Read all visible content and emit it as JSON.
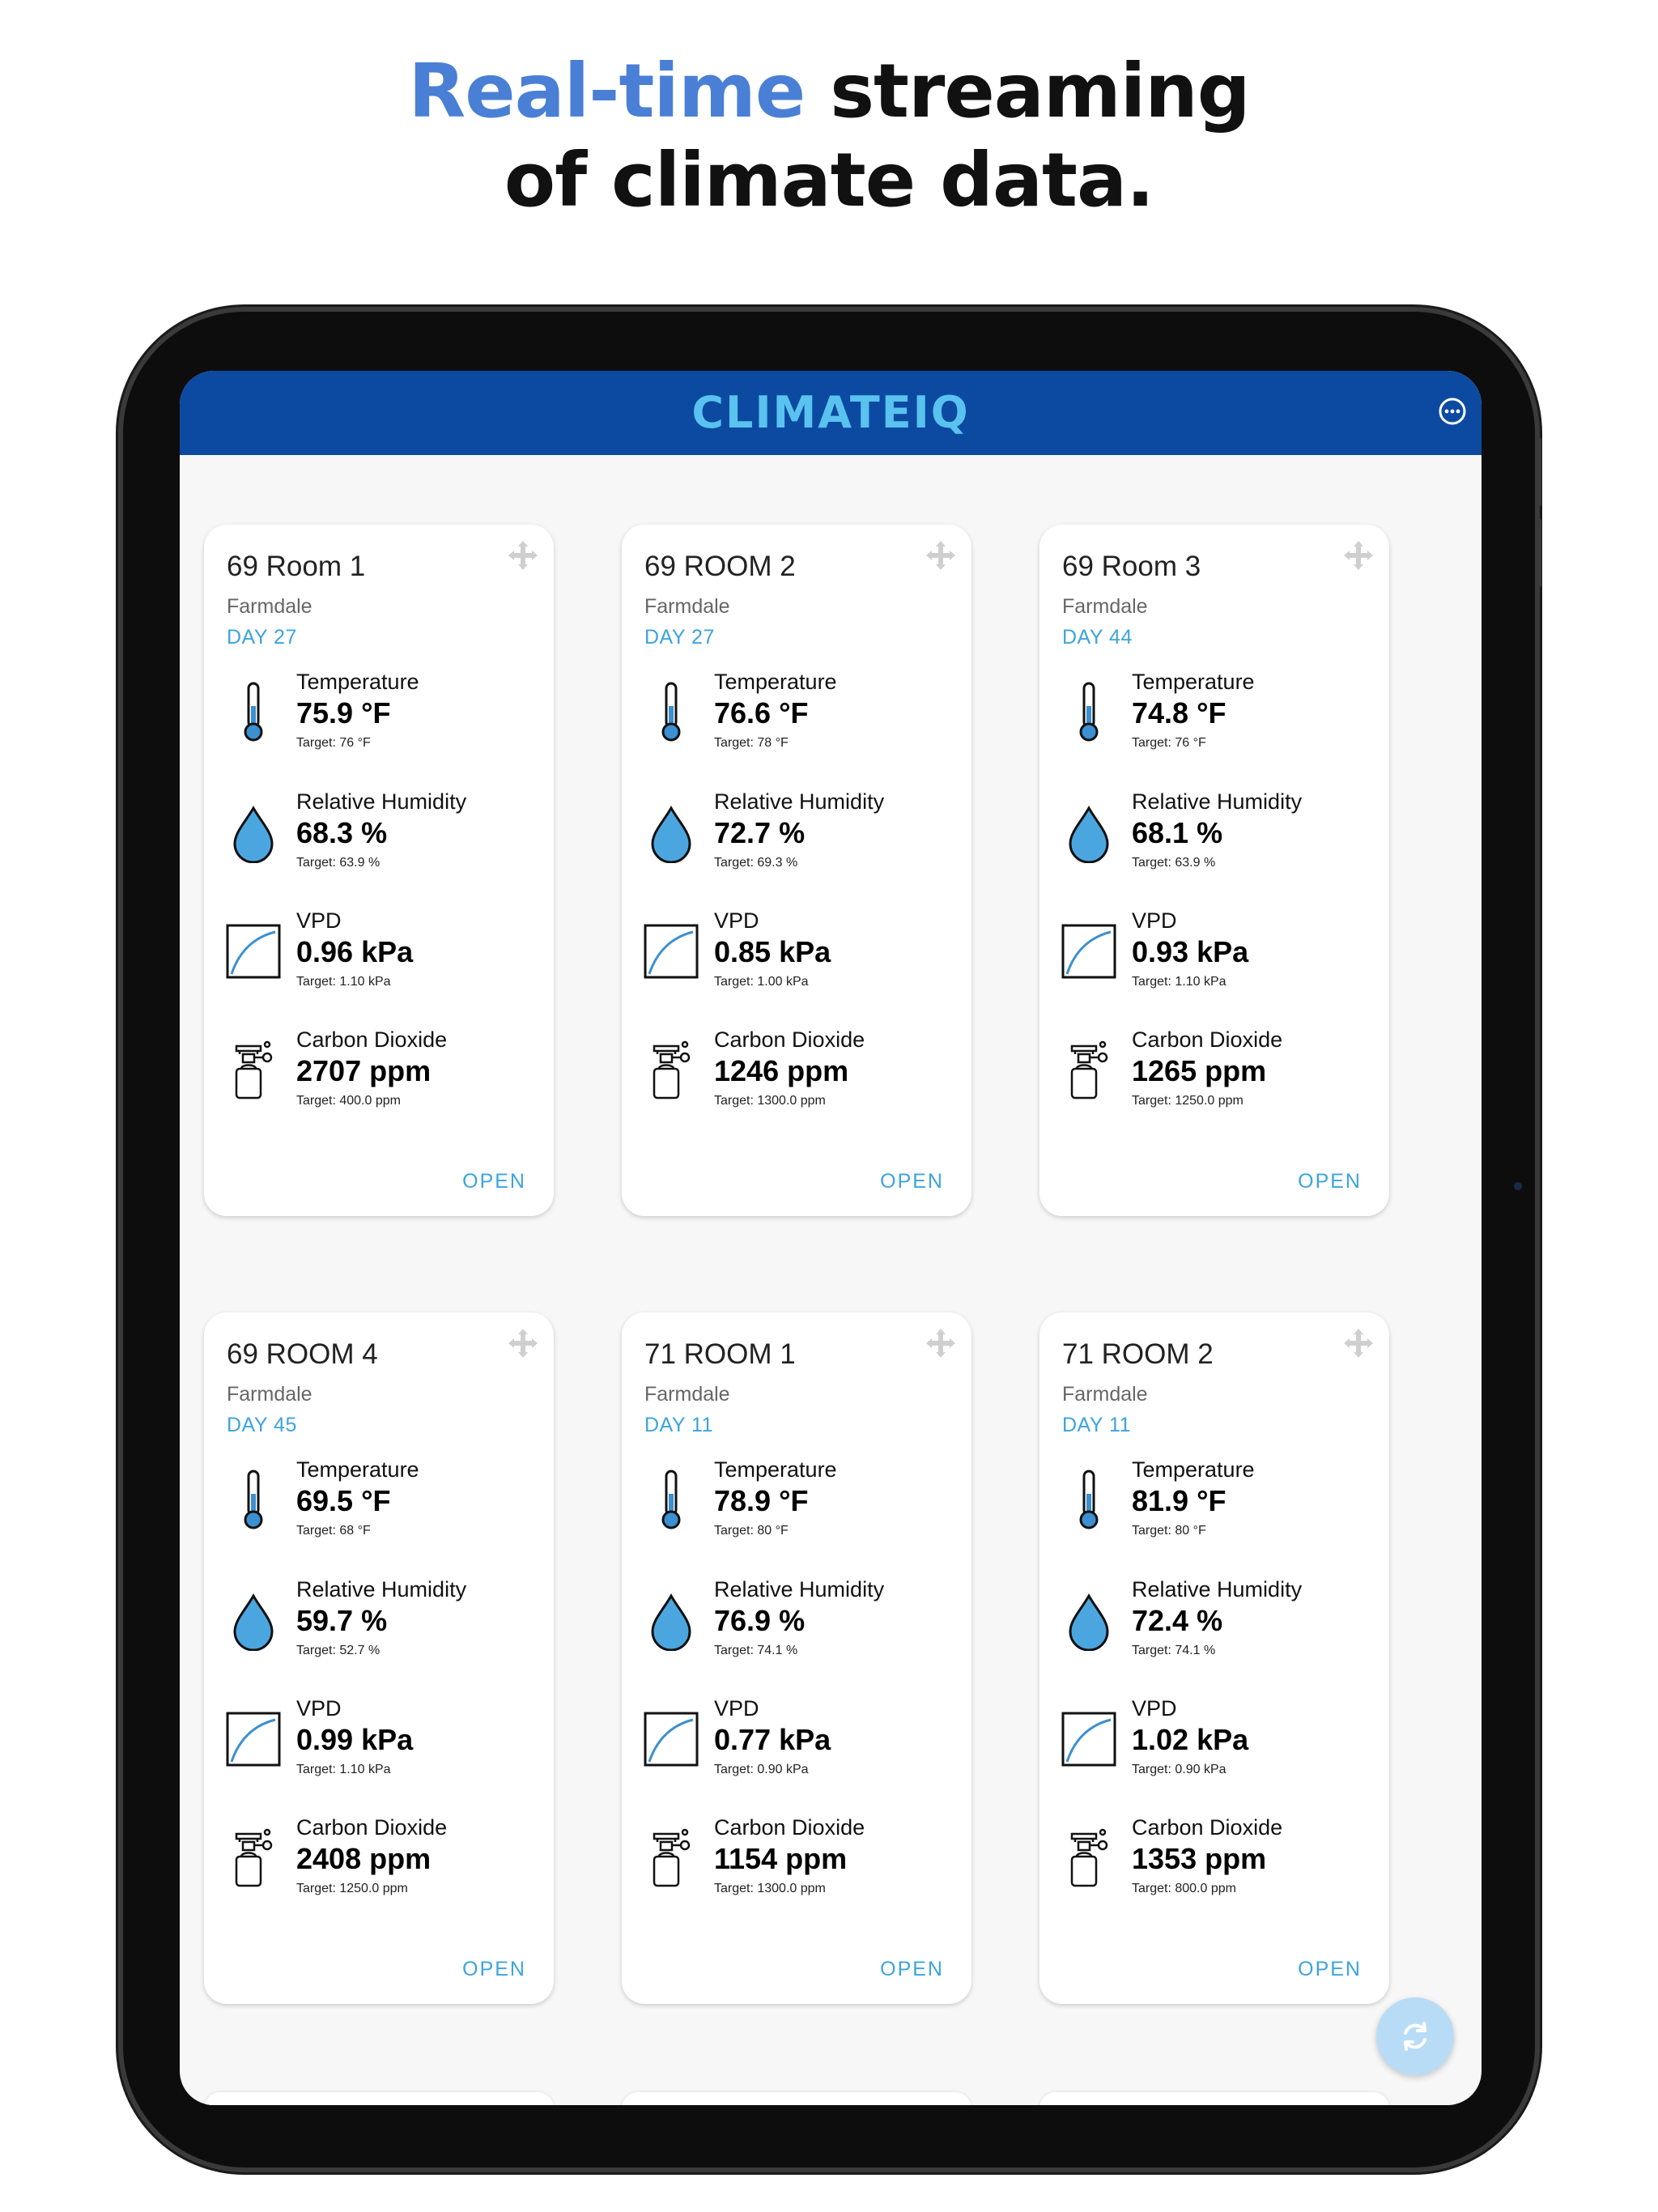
{
  "headline": {
    "accent": "Real-time",
    "line1_rest": " streaming",
    "line2": "of climate data."
  },
  "app": {
    "logo": "CLIMATEIQ",
    "colors": {
      "appbar": "#0c4aa2",
      "logo": "#5ac2ef",
      "accent": "#3ca4de",
      "fab": "#b9dcf6"
    }
  },
  "cards": [
    {
      "title": "69 Room 1",
      "location": "Farmdale",
      "day": "DAY 27",
      "temp": {
        "label": "Temperature",
        "value": "75.9 °F",
        "target": "Target: 76 °F"
      },
      "rh": {
        "label": "Relative Humidity",
        "value": "68.3 %",
        "target": "Target: 63.9 %"
      },
      "vpd": {
        "label": "VPD",
        "value": "0.96 kPa",
        "target": "Target: 1.10 kPa"
      },
      "co2": {
        "label": "Carbon Dioxide",
        "value": "2707 ppm",
        "target": "Target: 400.0 ppm"
      },
      "open": "OPEN"
    },
    {
      "title": "69 ROOM 2",
      "location": "Farmdale",
      "day": "DAY 27",
      "temp": {
        "label": "Temperature",
        "value": "76.6 °F",
        "target": "Target: 78 °F"
      },
      "rh": {
        "label": "Relative Humidity",
        "value": "72.7 %",
        "target": "Target: 69.3 %"
      },
      "vpd": {
        "label": "VPD",
        "value": "0.85 kPa",
        "target": "Target: 1.00 kPa"
      },
      "co2": {
        "label": "Carbon Dioxide",
        "value": "1246 ppm",
        "target": "Target: 1300.0 ppm"
      },
      "open": "OPEN"
    },
    {
      "title": "69 Room 3",
      "location": "Farmdale",
      "day": "DAY 44",
      "temp": {
        "label": "Temperature",
        "value": "74.8 °F",
        "target": "Target: 76 °F"
      },
      "rh": {
        "label": "Relative Humidity",
        "value": "68.1 %",
        "target": "Target: 63.9 %"
      },
      "vpd": {
        "label": "VPD",
        "value": "0.93 kPa",
        "target": "Target: 1.10 kPa"
      },
      "co2": {
        "label": "Carbon Dioxide",
        "value": "1265 ppm",
        "target": "Target: 1250.0 ppm"
      },
      "open": "OPEN"
    },
    {
      "title": "69 ROOM 4",
      "location": "Farmdale",
      "day": "DAY 45",
      "temp": {
        "label": "Temperature",
        "value": "69.5 °F",
        "target": "Target: 68 °F"
      },
      "rh": {
        "label": "Relative Humidity",
        "value": "59.7 %",
        "target": "Target: 52.7 %"
      },
      "vpd": {
        "label": "VPD",
        "value": "0.99 kPa",
        "target": "Target: 1.10 kPa"
      },
      "co2": {
        "label": "Carbon Dioxide",
        "value": "2408 ppm",
        "target": "Target: 1250.0 ppm"
      },
      "open": "OPEN"
    },
    {
      "title": "71 ROOM 1",
      "location": "Farmdale",
      "day": "DAY 11",
      "temp": {
        "label": "Temperature",
        "value": "78.9 °F",
        "target": "Target: 80 °F"
      },
      "rh": {
        "label": "Relative Humidity",
        "value": "76.9 %",
        "target": "Target: 74.1 %"
      },
      "vpd": {
        "label": "VPD",
        "value": "0.77 kPa",
        "target": "Target: 0.90 kPa"
      },
      "co2": {
        "label": "Carbon Dioxide",
        "value": "1154 ppm",
        "target": "Target: 1300.0 ppm"
      },
      "open": "OPEN"
    },
    {
      "title": "71 ROOM 2",
      "location": "Farmdale",
      "day": "DAY 11",
      "temp": {
        "label": "Temperature",
        "value": "81.9 °F",
        "target": "Target: 80 °F"
      },
      "rh": {
        "label": "Relative Humidity",
        "value": "72.4 %",
        "target": "Target: 74.1 %"
      },
      "vpd": {
        "label": "VPD",
        "value": "1.02 kPa",
        "target": "Target: 0.90 kPa"
      },
      "co2": {
        "label": "Carbon Dioxide",
        "value": "1353 ppm",
        "target": "Target: 800.0 ppm"
      },
      "open": "OPEN"
    }
  ],
  "icons": {
    "menu": "more-horizontal-icon",
    "move": "drag-move-icon",
    "temp": "thermometer-icon",
    "rh": "water-drop-icon",
    "vpd": "vpd-curve-icon",
    "co2": "co2-tank-icon",
    "fab": "refresh-icon"
  }
}
